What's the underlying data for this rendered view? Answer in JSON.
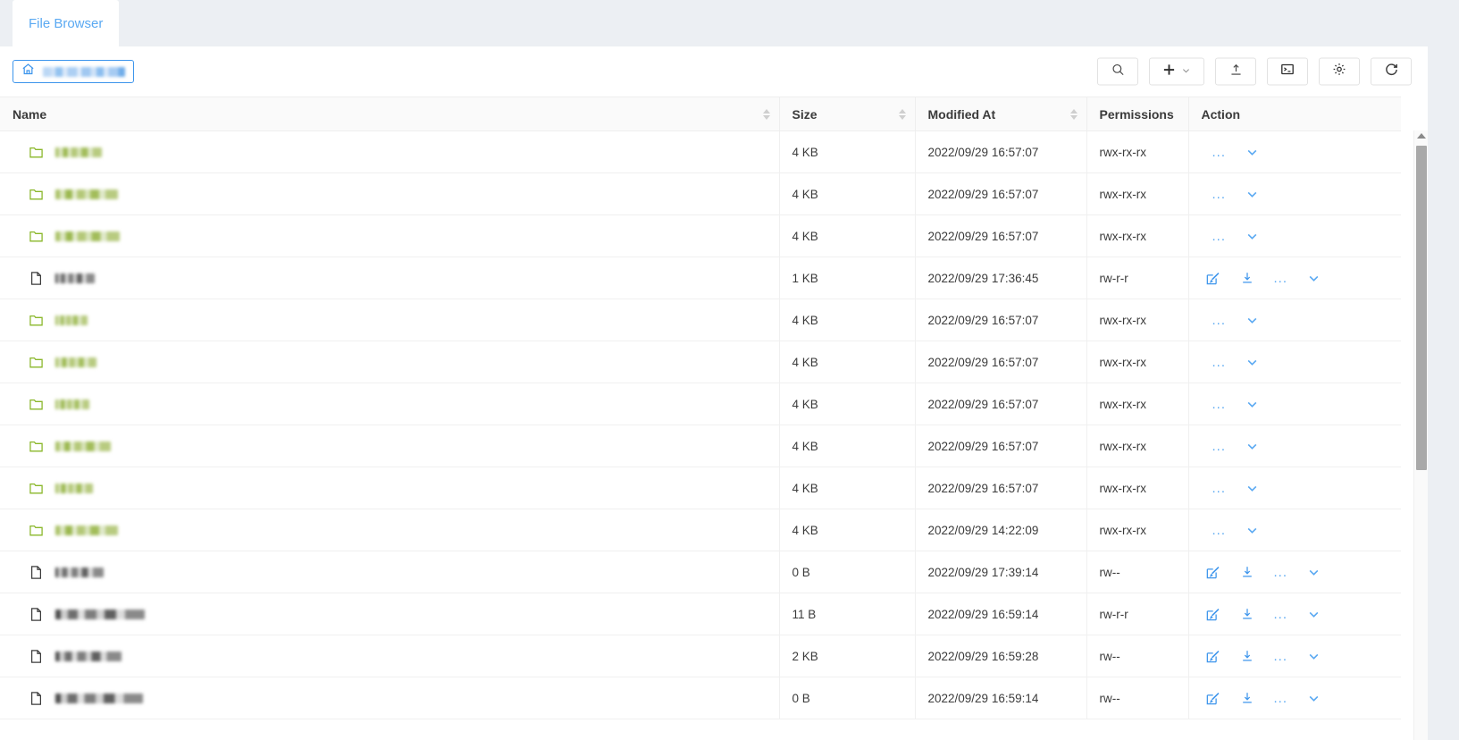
{
  "tab": {
    "label": "File Browser"
  },
  "breadcrumb": {
    "home_icon": "home-icon",
    "path_redacted": true
  },
  "toolbar": {
    "buttons": [
      {
        "name": "search-button",
        "icon": "search-icon"
      },
      {
        "name": "new-button",
        "icon": "plus-icon",
        "caret": "chevron-down-icon"
      },
      {
        "name": "upload-button",
        "icon": "upload-icon"
      },
      {
        "name": "terminal-button",
        "icon": "terminal-icon"
      },
      {
        "name": "settings-button",
        "icon": "gear-icon"
      },
      {
        "name": "refresh-button",
        "icon": "refresh-icon"
      }
    ]
  },
  "table": {
    "columns": [
      {
        "key": "name",
        "label": "Name",
        "sortable": true
      },
      {
        "key": "size",
        "label": "Size",
        "sortable": true
      },
      {
        "key": "modified_at",
        "label": "Modified At",
        "sortable": true
      },
      {
        "key": "permissions",
        "label": "Permissions",
        "sortable": false
      },
      {
        "key": "action",
        "label": "Action",
        "sortable": false
      }
    ],
    "rows": [
      {
        "type": "dir",
        "name_redacted": true,
        "name_width": 52,
        "size": "4 KB",
        "modified_at": "2022/09/29 16:57:07",
        "permissions": "rwx-rx-rx",
        "actions": [
          "more-icon",
          "chevron-down-icon"
        ]
      },
      {
        "type": "dir",
        "name_redacted": true,
        "name_width": 70,
        "size": "4 KB",
        "modified_at": "2022/09/29 16:57:07",
        "permissions": "rwx-rx-rx",
        "actions": [
          "more-icon",
          "chevron-down-icon"
        ]
      },
      {
        "type": "dir",
        "name_redacted": true,
        "name_width": 72,
        "size": "4 KB",
        "modified_at": "2022/09/29 16:57:07",
        "permissions": "rwx-rx-rx",
        "actions": [
          "more-icon",
          "chevron-down-icon"
        ]
      },
      {
        "type": "file",
        "name_redacted": true,
        "name_width": 44,
        "size": "1 KB",
        "modified_at": "2022/09/29 17:36:45",
        "permissions": "rw-r-r",
        "actions": [
          "edit-icon",
          "download-icon",
          "more-icon",
          "chevron-down-icon"
        ]
      },
      {
        "type": "dir",
        "name_redacted": true,
        "name_width": 36,
        "size": "4 KB",
        "modified_at": "2022/09/29 16:57:07",
        "permissions": "rwx-rx-rx",
        "actions": [
          "more-icon",
          "chevron-down-icon"
        ]
      },
      {
        "type": "dir",
        "name_redacted": true,
        "name_width": 46,
        "size": "4 KB",
        "modified_at": "2022/09/29 16:57:07",
        "permissions": "rwx-rx-rx",
        "actions": [
          "more-icon",
          "chevron-down-icon"
        ]
      },
      {
        "type": "dir",
        "name_redacted": true,
        "name_width": 38,
        "size": "4 KB",
        "modified_at": "2022/09/29 16:57:07",
        "permissions": "rwx-rx-rx",
        "actions": [
          "more-icon",
          "chevron-down-icon"
        ]
      },
      {
        "type": "dir",
        "name_redacted": true,
        "name_width": 62,
        "size": "4 KB",
        "modified_at": "2022/09/29 16:57:07",
        "permissions": "rwx-rx-rx",
        "actions": [
          "more-icon",
          "chevron-down-icon"
        ]
      },
      {
        "type": "dir",
        "name_redacted": true,
        "name_width": 42,
        "size": "4 KB",
        "modified_at": "2022/09/29 16:57:07",
        "permissions": "rwx-rx-rx",
        "actions": [
          "more-icon",
          "chevron-down-icon"
        ]
      },
      {
        "type": "dir",
        "name_redacted": true,
        "name_width": 70,
        "size": "4 KB",
        "modified_at": "2022/09/29 14:22:09",
        "permissions": "rwx-rx-rx",
        "actions": [
          "more-icon",
          "chevron-down-icon"
        ]
      },
      {
        "type": "file",
        "name_redacted": true,
        "name_width": 54,
        "size": "0 B",
        "modified_at": "2022/09/29 17:39:14",
        "permissions": "rw--",
        "actions": [
          "edit-icon",
          "download-icon",
          "more-icon",
          "chevron-down-icon"
        ]
      },
      {
        "type": "file",
        "name_redacted": true,
        "name_width": 100,
        "size": "11 B",
        "modified_at": "2022/09/29 16:59:14",
        "permissions": "rw-r-r",
        "actions": [
          "edit-icon",
          "download-icon",
          "more-icon",
          "chevron-down-icon"
        ]
      },
      {
        "type": "file",
        "name_redacted": true,
        "name_width": 74,
        "size": "2 KB",
        "modified_at": "2022/09/29 16:59:28",
        "permissions": "rw--",
        "actions": [
          "edit-icon",
          "download-icon",
          "more-icon",
          "chevron-down-icon"
        ]
      },
      {
        "type": "file",
        "name_redacted": true,
        "name_width": 98,
        "size": "0 B",
        "modified_at": "2022/09/29 16:59:14",
        "permissions": "rw--",
        "actions": [
          "edit-icon",
          "download-icon",
          "more-icon",
          "chevron-down-icon"
        ]
      }
    ]
  },
  "scrollbar": {
    "up_arrow": "triangle-up-icon",
    "thumb_visible": true
  },
  "colors": {
    "accent_blue": "#3d95ec",
    "link_blue": "#5aa9f2",
    "folder_green": "#8ab72a",
    "text": "#3b3b3b",
    "page_bg": "#eceff3",
    "panel_bg": "#ffffff",
    "header_bg": "#fafafa",
    "border": "#eeeeee"
  }
}
